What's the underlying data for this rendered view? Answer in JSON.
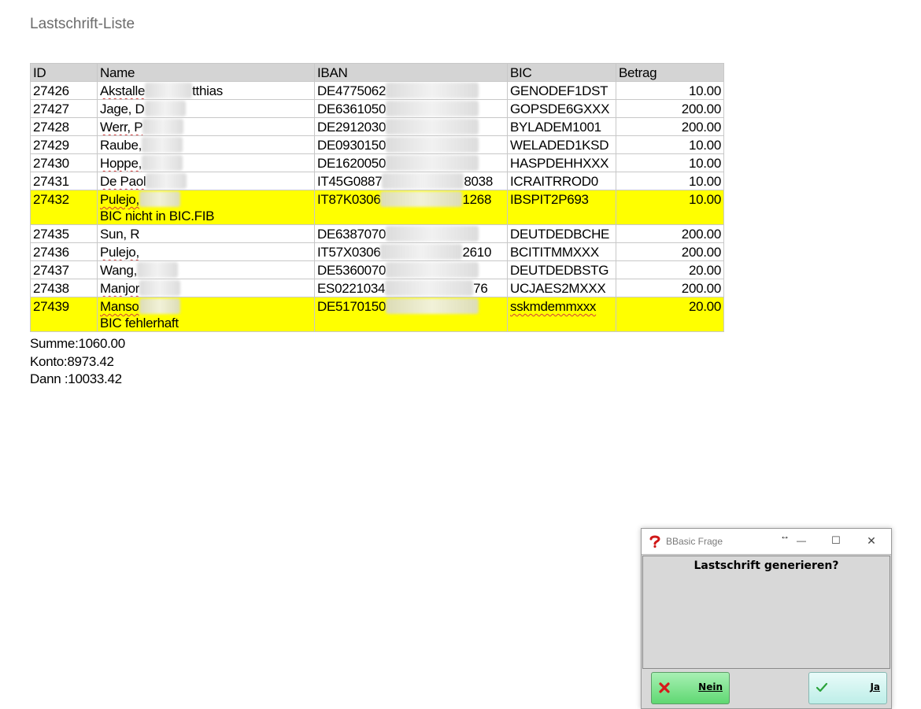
{
  "page": {
    "title": "Lastschrift-Liste"
  },
  "table": {
    "headers": {
      "id": "ID",
      "name": "Name",
      "iban": "IBAN",
      "bic": "BIC",
      "amount": "Betrag"
    },
    "rows": [
      {
        "id": "27426",
        "name_a": "Akstalle",
        "name_b": "",
        "name_c": "tthias",
        "iban_a": "DE4775062",
        "iban_b": "",
        "bic": "GENODEF1DST",
        "amount": "10.00",
        "error": "",
        "highlight": false
      },
      {
        "id": "27427",
        "name_a": "Jage, D",
        "name_b": "",
        "name_c": "",
        "iban_a": "DE6361050",
        "iban_b": "",
        "bic": "GOPSDE6GXXX",
        "amount": "200.00",
        "error": "",
        "highlight": false
      },
      {
        "id": "27428",
        "name_a": "Werr, P",
        "name_b": "",
        "name_c": "",
        "iban_a": "DE2912030",
        "iban_b": "",
        "bic": "BYLADEM1001",
        "amount": "200.00",
        "error": "",
        "highlight": false
      },
      {
        "id": "27429",
        "name_a": "Raube,",
        "name_b": "",
        "name_c": "",
        "iban_a": "DE0930150",
        "iban_b": "",
        "bic": "WELADED1KSD",
        "amount": "10.00",
        "error": "",
        "highlight": false
      },
      {
        "id": "27430",
        "name_a": "Hoppe,",
        "name_b": "",
        "name_c": "",
        "iban_a": "DE1620050",
        "iban_b": "",
        "bic": "HASPDEHHXXX",
        "amount": "10.00",
        "error": "",
        "highlight": false
      },
      {
        "id": "27431",
        "name_a": "De Paol",
        "name_b": "",
        "name_c": "",
        "iban_a": "IT45G0887",
        "iban_b": "8038",
        "bic": "ICRAITRROD0",
        "amount": "10.00",
        "error": "",
        "highlight": false
      },
      {
        "id": "27432",
        "name_a": "Pulejo,",
        "name_b": "",
        "name_c": "",
        "iban_a": "IT87K0306",
        "iban_b": "1268",
        "bic": "IBSPIT2P693",
        "amount": "10.00",
        "error": "BIC nicht in BIC.FIB",
        "highlight": true
      },
      {
        "id": "27435",
        "name_a": "Sun, R",
        "name_b": "",
        "name_c": "",
        "iban_a": "DE6387070",
        "iban_b": "",
        "bic": "DEUTDEDBCHE",
        "amount": "200.00",
        "error": "",
        "highlight": false
      },
      {
        "id": "27436",
        "name_a": "Pulejo,",
        "name_b": "",
        "name_c": "",
        "iban_a": "IT57X0306",
        "iban_b": "2610",
        "bic": "BCITITMMXXX",
        "amount": "200.00",
        "error": "",
        "highlight": false
      },
      {
        "id": "27437",
        "name_a": "Wang,",
        "name_b": "",
        "name_c": "",
        "iban_a": "DE5360070",
        "iban_b": "",
        "bic": "DEUTDEDBSTG",
        "amount": "20.00",
        "error": "",
        "highlight": false
      },
      {
        "id": "27438",
        "name_a": "Manjor",
        "name_b": "",
        "name_c": "",
        "iban_a": "ES0221034",
        "iban_b": "76",
        "bic": "UCJAES2MXXX",
        "amount": "200.00",
        "error": "",
        "highlight": false
      },
      {
        "id": "27439",
        "name_a": "Manso",
        "name_b": "",
        "name_c": "",
        "iban_a": "DE5170150",
        "iban_b": "",
        "bic": "sskmdemmxxx",
        "amount": "20.00",
        "error": "BIC fehlerhaft",
        "highlight": true
      }
    ]
  },
  "summary": {
    "sum": "Summe:1060.00",
    "account": "Konto:8973.42",
    "then": "Dann :10033.42"
  },
  "dialog": {
    "title": "BBasic Frage",
    "resize_glyph": "↔",
    "minimize": "—",
    "maximize": "☐",
    "close": "✕",
    "question": "Lastschrift generieren?",
    "no_label": "Nein",
    "yes_label": "Ja"
  },
  "icons": {
    "app": "question-mark-icon",
    "no": "x-icon",
    "yes": "checkmark-icon"
  },
  "colors": {
    "highlight": "#ffff00",
    "header_bg": "#d4d4d4",
    "no_button": "#5fd872",
    "yes_button": "#bdeee8"
  }
}
